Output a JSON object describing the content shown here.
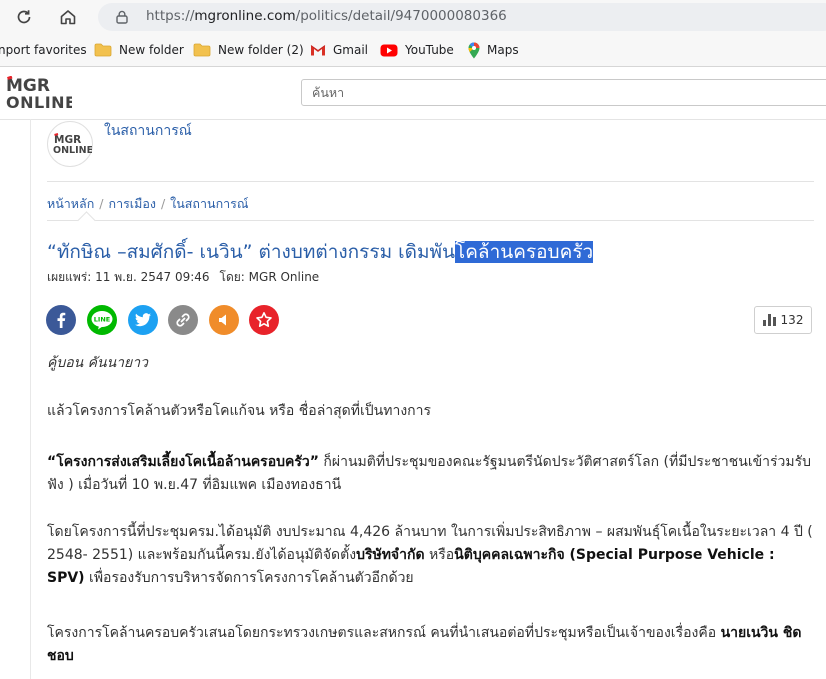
{
  "browser": {
    "url_prefix": "https://",
    "url_domain": "mgronline.com",
    "url_path": "/politics/detail/9470000080366"
  },
  "bookmarks": [
    {
      "label": "nport favorites",
      "icon": "import-favorites-icon"
    },
    {
      "label": "New folder",
      "icon": "folder-icon"
    },
    {
      "label": "New folder (2)",
      "icon": "folder-icon"
    },
    {
      "label": "Gmail",
      "icon": "gmail-icon"
    },
    {
      "label": "YouTube",
      "icon": "youtube-icon"
    },
    {
      "label": "Maps",
      "icon": "maps-icon"
    }
  ],
  "site": {
    "logo_top": "MGR",
    "logo_bottom": "ONLINE",
    "search_placeholder": "ค้นหา"
  },
  "category": {
    "name": "ในสถานการณ์",
    "avatar_top": "MGR",
    "avatar_bottom": "ONLINE"
  },
  "breadcrumb": [
    "หน้าหลัก",
    "การเมือง",
    "ในสถานการณ์"
  ],
  "article": {
    "title_plain": "“ทักษิณ –สมศักดิ์- เนวิน” ต่างบทต่างกรรม เดิมพัน",
    "title_highlighted": "โคล้านครอบครัว",
    "published_label": "เผยแพร่:",
    "published_value": "11 พ.ย. 2547 09:46",
    "author_label": "โดย:",
    "author_value": "MGR Online",
    "views": "132",
    "byline": "คู้บอน คันนายาว",
    "p1": "แล้วโครงการโคล้านตัวหรือโคแก้จน หรือ ชื่อล่าสุดที่เป็นทางการ",
    "p2_bold": "“โครงการส่งเสริมเลี้ยงโคเนื้อล้านครอบครัว”",
    "p2_rest": " ก็ผ่านมติที่ประชุมของคณะรัฐมนตรีนัดประวัติศาสตร์โลก (ที่มีประชาชนเข้าร่วมรับฟัง ) เมื่อวันที่ 10 พ.ย.47 ที่อิมแพค เมืองทองธานี",
    "p3_a": "โดยโครงการนี้ที่ประชุมครม.ได้อนุมัติ งบประมาณ 4,426 ล้านบาท ในการเพิ่มประสิทธิภาพ – ผสมพันธุ์โคเนื้อในระยะเวลา 4 ปี ( 2548- 2551) และพร้อมกันนี้ครม.ยังได้อนุมัติจัดตั้ง",
    "p3_b1": "บริษัทจำกัด",
    "p3_c": " หรือ",
    "p3_b2": "นิติบุคคลเฉพาะกิจ (Special Purpose Vehicle : SPV)",
    "p3_d": " เพื่อรองรับการบริหารจัดการโครงการโคล้านตัวอีกด้วย",
    "p4_a": "โครงการโคล้านครอบครัวเสนอโดยกระทรวงเกษตรและสหกรณ์ คนที่นำเสนอต่อที่ประชุมหรือเป็นเจ้าของเรื่องคือ ",
    "p4_bold": "นายเนวิน ชิดชอบ"
  },
  "share_buttons": [
    {
      "name": "facebook",
      "color": "#3b5998"
    },
    {
      "name": "line",
      "color": "#00b900",
      "label": "LINE"
    },
    {
      "name": "twitter",
      "color": "#1da1f2"
    },
    {
      "name": "copy-link",
      "color": "#8a8a8a"
    },
    {
      "name": "speaker",
      "color": "#f08c2a"
    },
    {
      "name": "favorite",
      "color": "#e8232a"
    }
  ]
}
